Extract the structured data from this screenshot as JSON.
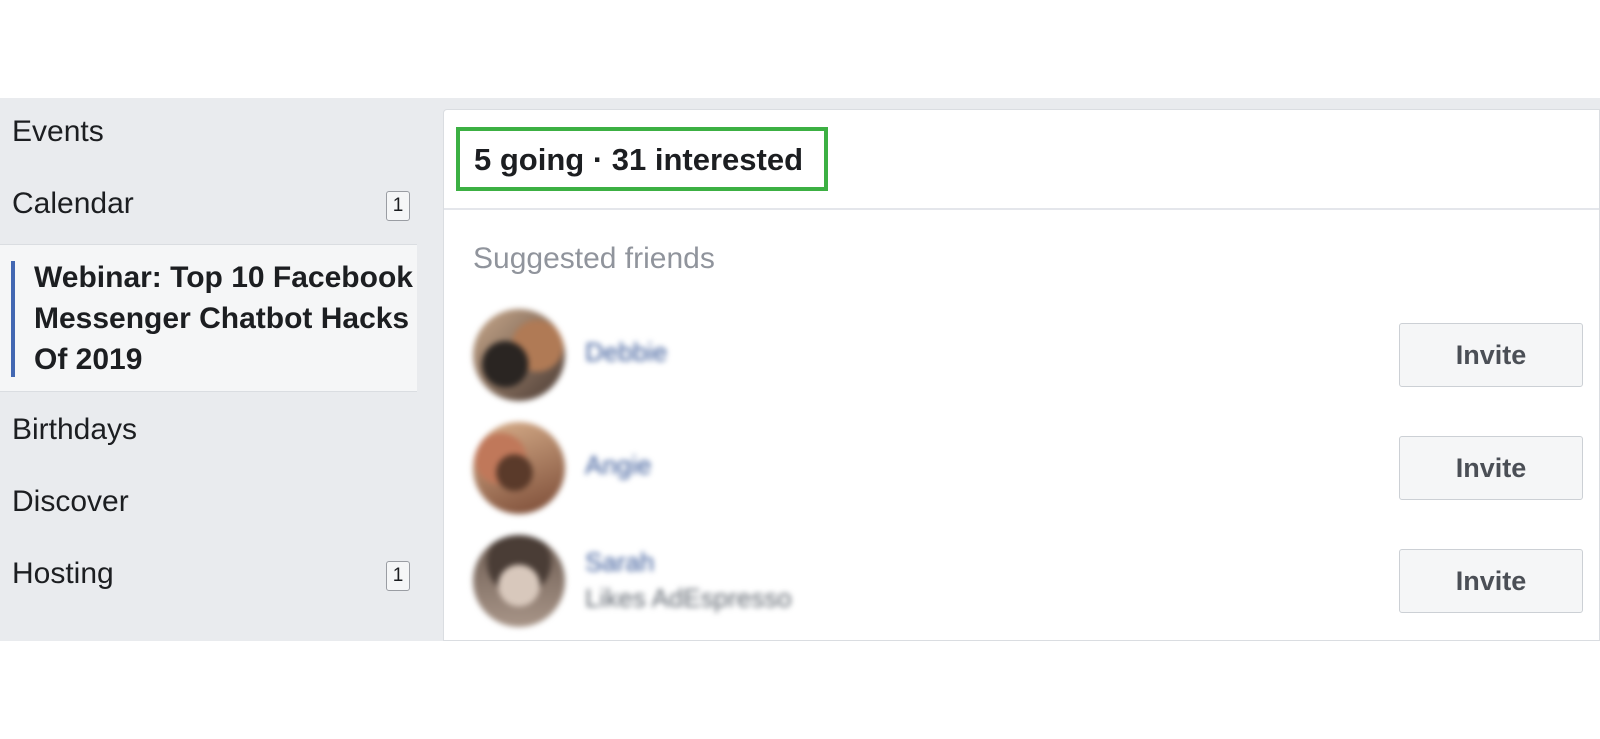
{
  "sidebar": {
    "items": [
      {
        "label": "Events"
      },
      {
        "label": "Calendar",
        "badge": "1"
      },
      {
        "label": "Webinar: Top 10 Facebook Messenger Chatbot Hacks Of 2019",
        "active": true
      },
      {
        "label": "Birthdays"
      },
      {
        "label": "Discover"
      },
      {
        "label": "Hosting",
        "badge": "1"
      }
    ]
  },
  "main": {
    "stats": "5 going · 31 interested",
    "suggested_title": "Suggested friends",
    "friends": [
      {
        "name": "Debbie",
        "sub": "",
        "invite_label": "Invite"
      },
      {
        "name": "Angie",
        "sub": "",
        "invite_label": "Invite"
      },
      {
        "name": "Sarah",
        "sub": "Likes AdEspresso",
        "invite_label": "Invite"
      }
    ]
  },
  "colors": {
    "highlight_border": "#3cb043",
    "active_bar": "#4267b2",
    "sidebar_bg": "#e9ebee",
    "link": "#385898"
  },
  "icons": {
    "avatar": "avatar-photo"
  }
}
